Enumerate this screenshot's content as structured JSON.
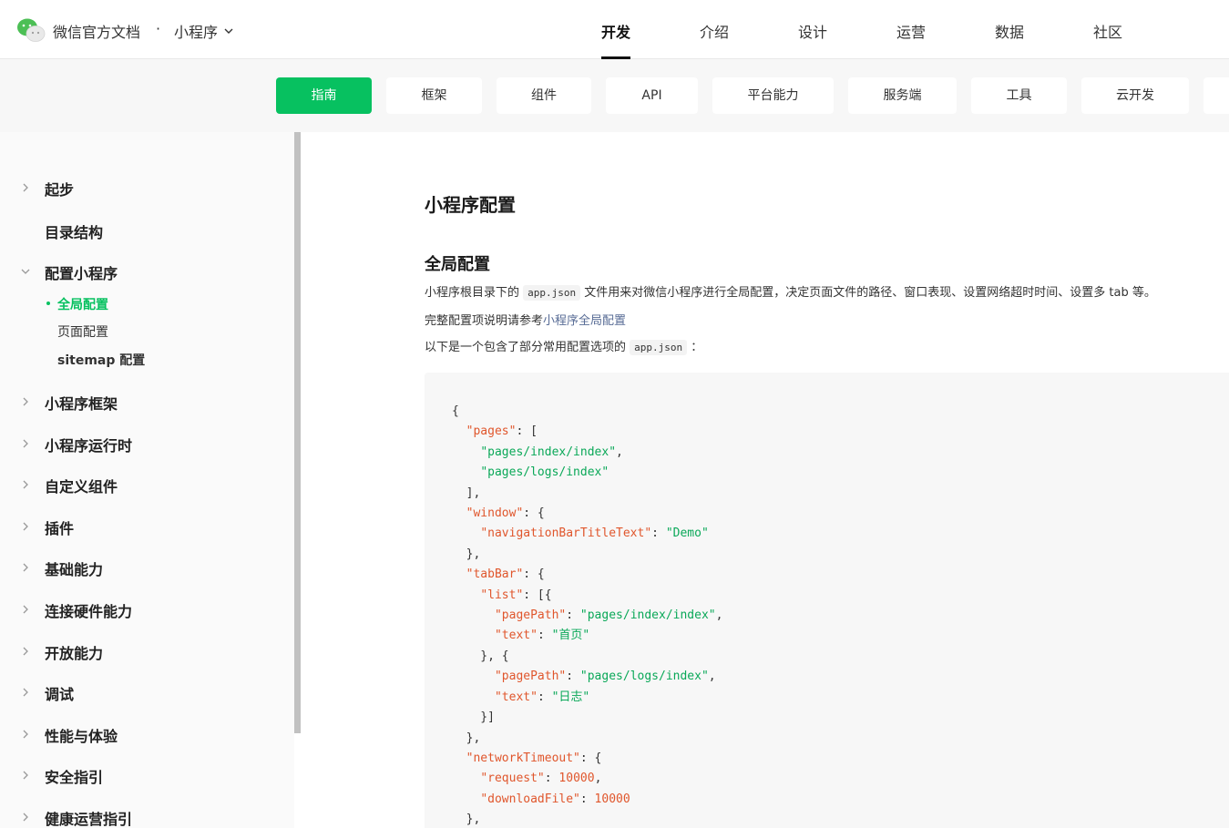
{
  "header": {
    "brand": "微信官方文档",
    "separator": "·",
    "product": "小程序",
    "nav": [
      "开发",
      "介绍",
      "设计",
      "运营",
      "数据",
      "社区"
    ],
    "active_nav": "开发"
  },
  "subnav": {
    "tabs": [
      "指南",
      "框架",
      "组件",
      "API",
      "平台能力",
      "服务端",
      "工具",
      "云开发"
    ],
    "active_tab": "指南"
  },
  "sidebar": {
    "items": [
      {
        "label": "起步",
        "expandable": true
      },
      {
        "label": "目录结构",
        "expandable": false
      },
      {
        "label": "配置小程序",
        "expandable": true,
        "expanded": true
      },
      {
        "label": "小程序框架",
        "expandable": true
      },
      {
        "label": "小程序运行时",
        "expandable": true
      },
      {
        "label": "自定义组件",
        "expandable": true
      },
      {
        "label": "插件",
        "expandable": true
      },
      {
        "label": "基础能力",
        "expandable": true
      },
      {
        "label": "连接硬件能力",
        "expandable": true
      },
      {
        "label": "开放能力",
        "expandable": true
      },
      {
        "label": "调试",
        "expandable": true
      },
      {
        "label": "性能与体验",
        "expandable": true
      },
      {
        "label": "安全指引",
        "expandable": true
      },
      {
        "label": "健康运营指引",
        "expandable": true
      }
    ],
    "sub_items": [
      {
        "label": "全局配置",
        "active": true
      },
      {
        "label": "页面配置",
        "active": false
      },
      {
        "label": "sitemap 配置",
        "active": false
      }
    ]
  },
  "main": {
    "title": "小程序配置",
    "section_title": "全局配置",
    "para1_prefix": "小程序根目录下的",
    "para1_code": "app.json",
    "para1_suffix": "文件用来对微信小程序进行全局配置，决定页面文件的路径、窗口表现、设置网络超时时间、设置多 tab 等。",
    "para2_prefix": "完整配置项说明请参考",
    "para2_link": "小程序全局配置",
    "para3_prefix": "以下是一个包含了部分常用配置选项的",
    "para3_code": "app.json",
    "para3_suffix": "："
  },
  "colors": {
    "accent": "#07c160",
    "link": "#576b95",
    "code_key": "#e0562c",
    "code_string": "#0aa858"
  }
}
